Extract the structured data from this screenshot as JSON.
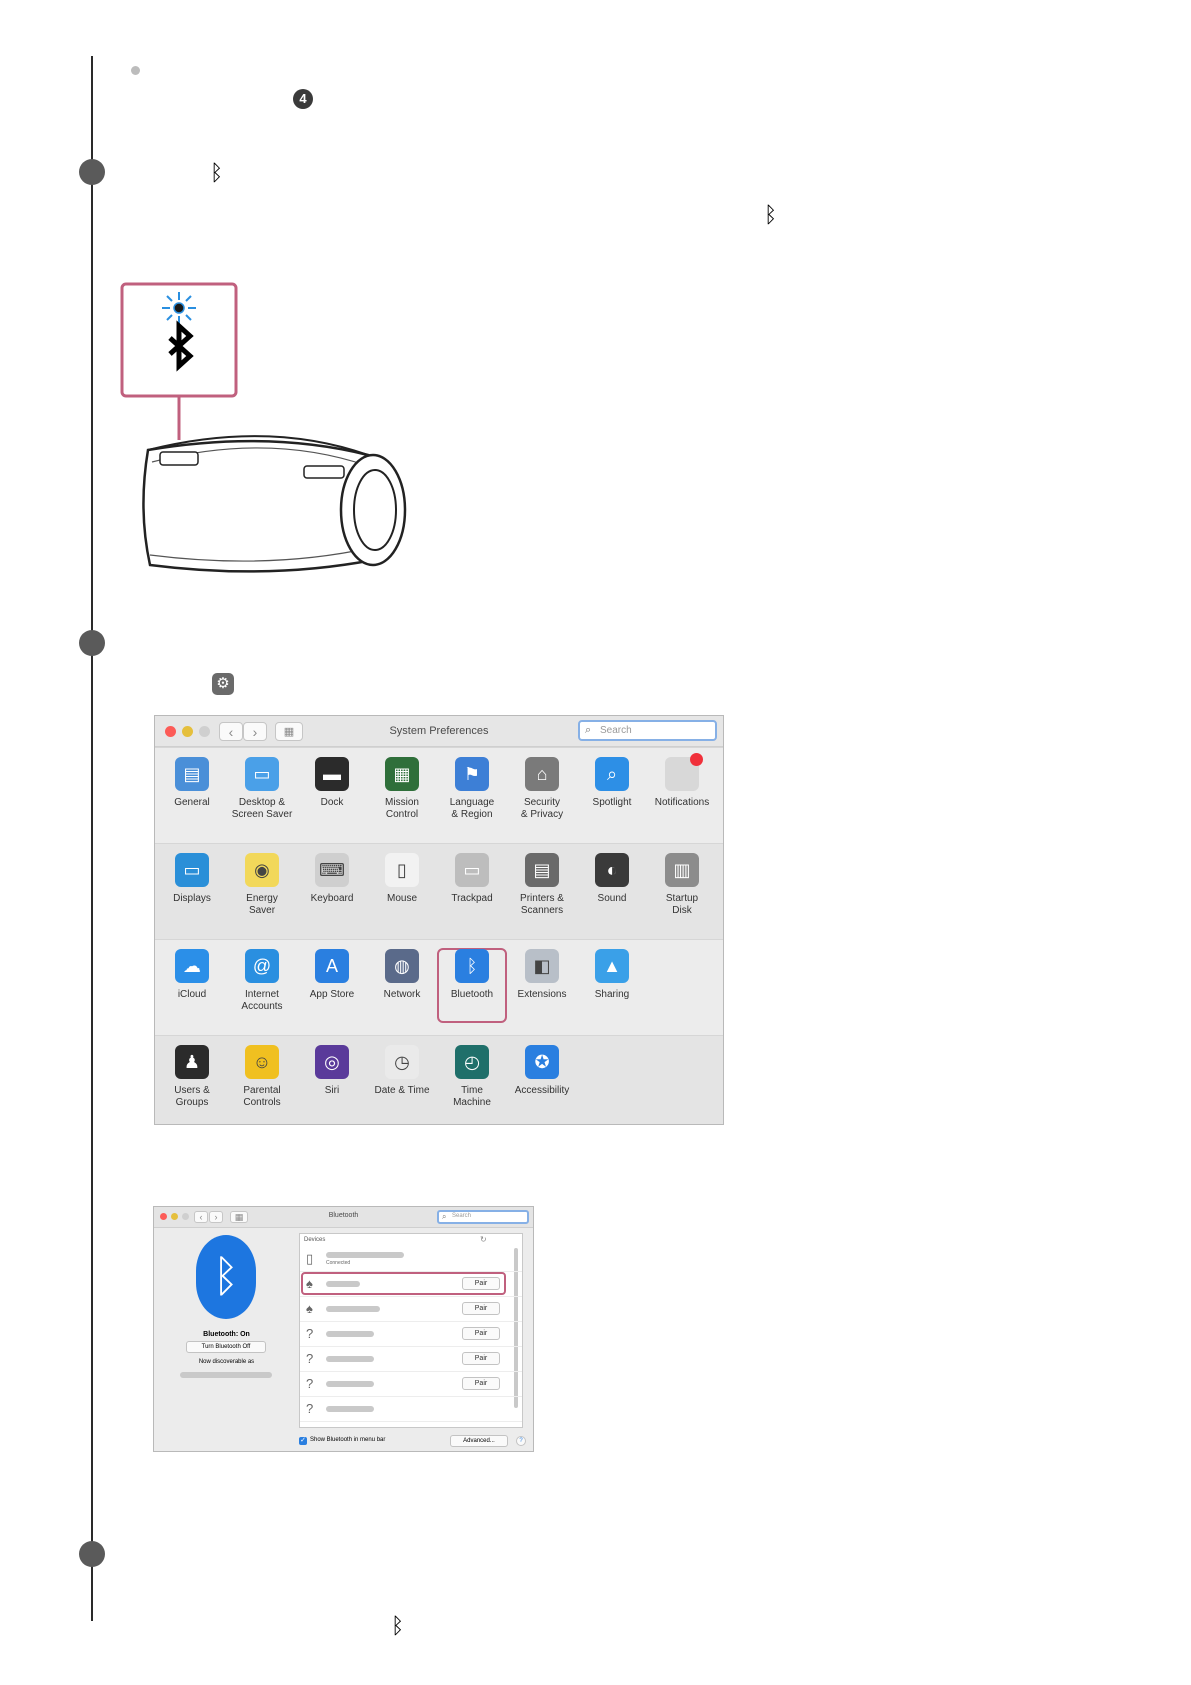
{
  "steps": {
    "circled_number": "4"
  },
  "sysprefs": {
    "title": "System Preferences",
    "search_placeholder": "Search",
    "rows": [
      [
        {
          "label": "General",
          "icon": "general-icon",
          "color": "#4a8fd8"
        },
        {
          "label": "Desktop &\nScreen Saver",
          "icon": "desktop-icon",
          "color": "#4aa0e8"
        },
        {
          "label": "Dock",
          "icon": "dock-icon",
          "color": "#2b2b2b"
        },
        {
          "label": "Mission\nControl",
          "icon": "mission-control-icon",
          "color": "#2f6f3a"
        },
        {
          "label": "Language\n& Region",
          "icon": "language-icon",
          "color": "#3d7fd6"
        },
        {
          "label": "Security\n& Privacy",
          "icon": "security-icon",
          "color": "#7a7a7a"
        },
        {
          "label": "Spotlight",
          "icon": "spotlight-icon",
          "color": "#2d8fe6"
        },
        {
          "label": "Notifications",
          "icon": "notifications-icon",
          "color": "#d8d8d8"
        }
      ],
      [
        {
          "label": "Displays",
          "icon": "displays-icon",
          "color": "#2a8fd8"
        },
        {
          "label": "Energy\nSaver",
          "icon": "energy-saver-icon",
          "color": "#f2d85a"
        },
        {
          "label": "Keyboard",
          "icon": "keyboard-icon",
          "color": "#cfcfcf"
        },
        {
          "label": "Mouse",
          "icon": "mouse-icon",
          "color": "#f2f2f2"
        },
        {
          "label": "Trackpad",
          "icon": "trackpad-icon",
          "color": "#bdbdbd"
        },
        {
          "label": "Printers &\nScanners",
          "icon": "printers-icon",
          "color": "#6a6a6a"
        },
        {
          "label": "Sound",
          "icon": "sound-icon",
          "color": "#3a3a3a"
        },
        {
          "label": "Startup\nDisk",
          "icon": "startup-disk-icon",
          "color": "#8c8c8c"
        }
      ],
      [
        {
          "label": "iCloud",
          "icon": "icloud-icon",
          "color": "#2b8fe8"
        },
        {
          "label": "Internet\nAccounts",
          "icon": "internet-accounts-icon",
          "color": "#2a8fe0"
        },
        {
          "label": "App Store",
          "icon": "app-store-icon",
          "color": "#2a7fe0"
        },
        {
          "label": "Network",
          "icon": "network-icon",
          "color": "#5a6a8a"
        },
        {
          "label": "Bluetooth",
          "icon": "bluetooth-icon",
          "color": "#2a7fe0"
        },
        {
          "label": "Extensions",
          "icon": "extensions-icon",
          "color": "#b8bfc8"
        },
        {
          "label": "Sharing",
          "icon": "sharing-icon",
          "color": "#3aa0e8"
        }
      ],
      [
        {
          "label": "Users &\nGroups",
          "icon": "users-groups-icon",
          "color": "#2b2b2b"
        },
        {
          "label": "Parental\nControls",
          "icon": "parental-controls-icon",
          "color": "#f0c020"
        },
        {
          "label": "Siri",
          "icon": "siri-icon",
          "color": "#5a3a9a"
        },
        {
          "label": "Date & Time",
          "icon": "date-time-icon",
          "color": "#eaeaea"
        },
        {
          "label": "Time\nMachine",
          "icon": "time-machine-icon",
          "color": "#1f6f6a"
        },
        {
          "label": "Accessibility",
          "icon": "accessibility-icon",
          "color": "#2a7fe0"
        }
      ]
    ]
  },
  "bt_window": {
    "title": "Bluetooth",
    "search_placeholder": "Search",
    "status": "Bluetooth: On",
    "turn_off_label": "Turn Bluetooth Off",
    "discoverable": "Now discoverable as",
    "devices_header": "Devices",
    "connected_label": "Connected",
    "pair_label": "Pair",
    "show_in_menu_bar": "Show Bluetooth in menu bar",
    "advanced_label": "Advanced...",
    "help_label": "?"
  }
}
